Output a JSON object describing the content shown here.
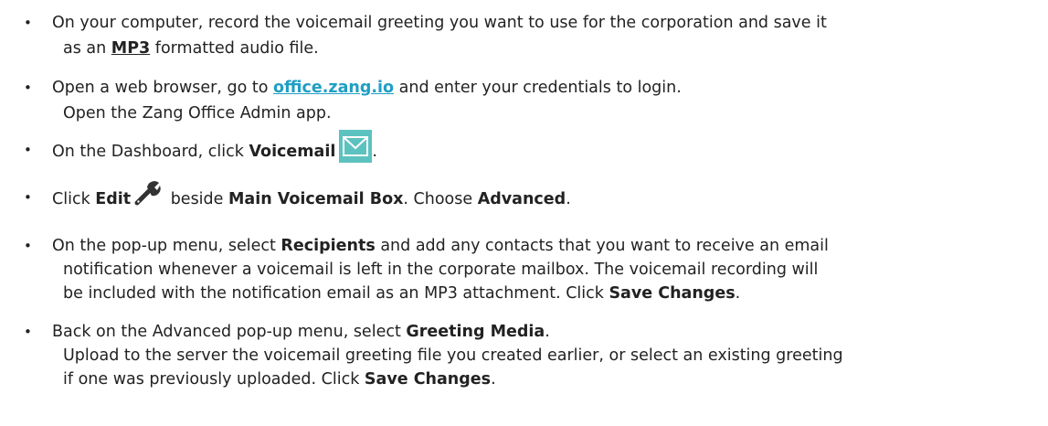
{
  "steps": [
    {
      "lines": [
        {
          "t1": "On your computer, record the voicemail greeting you want to use for the corporation and save it"
        },
        {
          "t1": "as an ",
          "b1": "MP3",
          "t2": " formatted audio file."
        }
      ]
    },
    {
      "lines": [
        {
          "t1": "Open a web browser, go to ",
          "link": "office.zang.io",
          "t2": " and enter your credentials to login."
        },
        {
          "t1": "Open the Zang Office Admin app."
        }
      ]
    },
    {
      "lines": [
        {
          "t1": "On the Dashboard, click ",
          "b1": "Voicemail",
          "t2": "."
        }
      ],
      "icon": "mail-icon"
    },
    {
      "lines": [
        {
          "t1": "Click ",
          "b1": "Edit",
          "t2": " beside ",
          "b2": "Main Voicemail Box",
          "t3": ".  Choose ",
          "b3": "Advanced",
          "t4": "."
        }
      ],
      "icon": "wrench-icon"
    },
    {
      "lines": [
        {
          "t1": "On the pop-up menu, select ",
          "b1": "Recipients",
          "t2": " and add any contacts that you want to receive an email"
        },
        {
          "t1": "notification whenever a voicemail is left in the corporate mailbox.  The voicemail recording will"
        },
        {
          "t1": "be included with the notification email as an MP3 attachment.  Click ",
          "b1": "Save Changes",
          "t2": "."
        }
      ]
    },
    {
      "lines": [
        {
          "t1": "Back on the Advanced pop-up menu, select ",
          "b1": "Greeting Media",
          "t2": "."
        },
        {
          "t1": "Upload to the server the voicemail greeting file you created earlier, or select an existing greeting"
        },
        {
          "t1": "if one was previously uploaded.  Click ",
          "b1": "Save Changes",
          "t2": "."
        }
      ]
    }
  ],
  "bullet": "•",
  "colors": {
    "link": "#1f9fc4",
    "mail_icon": "#5cc2bf",
    "text": "#222222"
  }
}
